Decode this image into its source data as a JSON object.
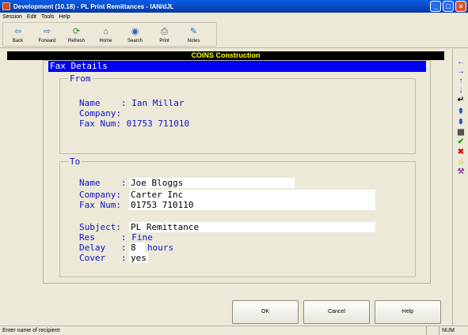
{
  "window": {
    "title": "Development (10.18) - PL Print Remittances - IAN/dJL",
    "controls": [
      "_",
      "□",
      "×"
    ]
  },
  "menu": {
    "items": [
      "Session",
      "Edit",
      "Tools",
      "Help"
    ]
  },
  "toolbar": {
    "buttons": [
      {
        "label": "Back",
        "icon": "back-arrow-icon"
      },
      {
        "label": "Forward",
        "icon": "forward-arrow-icon"
      },
      {
        "label": "Refresh",
        "icon": "refresh-icon"
      },
      {
        "label": "Home",
        "icon": "home-icon"
      },
      {
        "label": "Search",
        "icon": "search-icon"
      },
      {
        "label": "Print",
        "icon": "print-icon"
      },
      {
        "label": "Notes",
        "icon": "notes-icon"
      }
    ]
  },
  "header": {
    "company": "COINS Construction"
  },
  "fax": {
    "title": "Fax Details",
    "from": {
      "legend": "From",
      "name_label": "Name    : ",
      "name": "Ian Millar",
      "company_label": "Company: ",
      "company": "",
      "fax_label": "Fax Num: ",
      "fax": "01753 711010"
    },
    "to": {
      "legend": "To",
      "name_label": "Name    :",
      "name": "Joe Bloggs",
      "company_label": "Company:",
      "company": "Carter Inc",
      "fax_label": "Fax Num:",
      "fax": "01753 710110",
      "subject_label": "Subject:",
      "subject": "PL Remittance",
      "res_label": "Res     : ",
      "res": "Fine",
      "delay_label": "Delay   :",
      "delay": "8",
      "delay_unit": "hours",
      "cover_label": "Cover   :",
      "cover": "yes"
    }
  },
  "buttons": {
    "ok": "OK",
    "cancel": "Cancel",
    "help": "Help"
  },
  "rightbar": {
    "icons": [
      "arrow-left-icon",
      "arrow-right-icon",
      "arrow-up-icon",
      "arrow-down-icon",
      "enter-icon",
      "page-up-icon",
      "page-down-icon",
      "calculator-icon",
      "tick-icon",
      "cross-icon",
      "smiley-icon",
      "tools-icon"
    ]
  },
  "status": {
    "text": "Enter name of recipient",
    "num": "NUM"
  },
  "colors": {
    "title_bar": "#0843b8",
    "panel_title": "#0000f0",
    "header_bg": "#000000",
    "header_text": "#ffff00",
    "field_text": "#1010c8"
  }
}
